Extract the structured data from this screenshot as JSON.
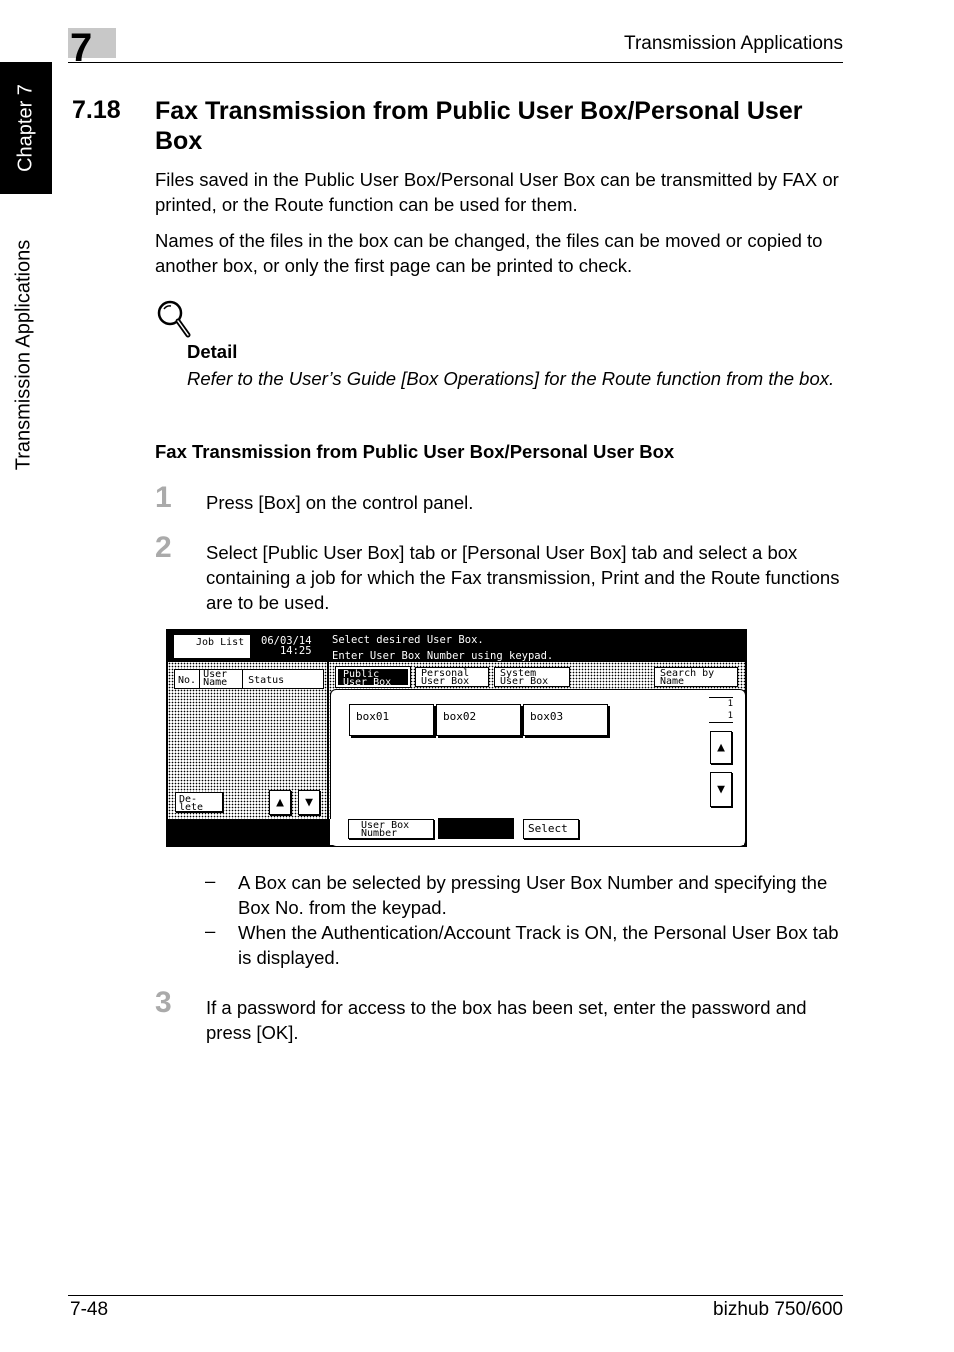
{
  "header": {
    "chapter_number": "7",
    "title": "Transmission Applications"
  },
  "side_tab": {
    "chapter_label": "Chapter 7",
    "section_label": "Transmission Applications"
  },
  "section": {
    "number": "7.18",
    "title": "Fax Transmission from Public User Box/Personal User Box",
    "paragraphs": [
      "Files saved in the Public User Box/Personal User Box can be transmitted by FAX or printed, or the Route function can be used for them.",
      "Names of the files in the box can be changed, the files can be moved or copied to another box, or only the first page can be printed to check."
    ]
  },
  "detail": {
    "icon": "magnifier-icon",
    "label": "Detail",
    "text": "Refer to the User’s Guide [Box Operations] for the Route function from the box."
  },
  "subheading": "Fax Transmission from Public User Box/Personal User Box",
  "steps": [
    {
      "number": "1",
      "text": "Press [Box] on the control panel."
    },
    {
      "number": "2",
      "text": "Select [Public User Box] tab or [Personal User Box] tab and select a box containing a job for which the Fax transmission, Print and the Route functions are to be used."
    },
    {
      "number": "3",
      "text": "If a password for access to the box has been set, enter the password and press [OK]."
    }
  ],
  "notes": [
    {
      "dash": "–",
      "text": "A Box can be selected by pressing User Box Number and specifying the Box No. from the keypad."
    },
    {
      "dash": "–",
      "text": "When the Authentication/Account Track is ON, the Personal User Box tab is displayed."
    }
  ],
  "screen": {
    "job_list_label": "Job List",
    "date": "06/03/14",
    "time": "14:25",
    "message_line1": "Select desired User Box.",
    "message_line2": "Enter User Box Number using keypad.",
    "col_no": "No.",
    "col_user_name": "User Name",
    "col_status": "Status",
    "delete_label": "De-lete",
    "tabs": [
      "Public User Box",
      "Personal User Box",
      "System User Box"
    ],
    "active_tab": "Public User Box",
    "search_label": "Search by Name",
    "boxes": [
      "box01",
      "box02",
      "box03"
    ],
    "page_indicator": [
      "1",
      "1"
    ],
    "user_box_number_label": "User Box Number",
    "select_label": "Select"
  },
  "footer": {
    "page": "7-48",
    "product": "bizhub 750/600"
  }
}
